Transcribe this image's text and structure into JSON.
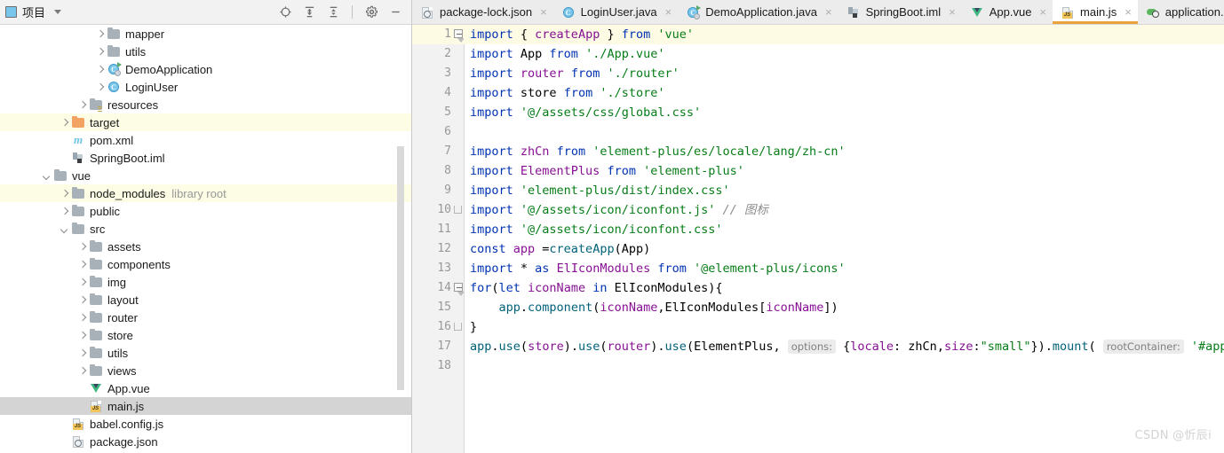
{
  "project_panel": {
    "title": "项目",
    "icon": "project-icon",
    "dropdown_icon": "chevron-down-icon",
    "tools": [
      {
        "name": "locate-file-icon",
        "label": "Select Opened File"
      },
      {
        "name": "expand-all-icon",
        "label": "Expand All"
      },
      {
        "name": "collapse-all-icon",
        "label": "Collapse All"
      },
      {
        "name": "gear-icon",
        "label": "Settings"
      },
      {
        "name": "minimize-icon",
        "label": "Hide"
      }
    ],
    "tree": [
      {
        "label": "mapper",
        "indent": 5,
        "arrow": "right",
        "icon": "folder-gray",
        "highlight": "none"
      },
      {
        "label": "utils",
        "indent": 5,
        "arrow": "right",
        "icon": "folder-gray",
        "highlight": "none"
      },
      {
        "label": "DemoApplication",
        "indent": 5,
        "arrow": "right",
        "icon": "java-class-run",
        "highlight": "none"
      },
      {
        "label": "LoginUser",
        "indent": 5,
        "arrow": "right",
        "icon": "java-class",
        "highlight": "none"
      },
      {
        "label": "resources",
        "indent": 4,
        "arrow": "right",
        "icon": "folder-res",
        "highlight": "none"
      },
      {
        "label": "target",
        "indent": 3,
        "arrow": "right",
        "icon": "folder-orange",
        "highlight": "yellow"
      },
      {
        "label": "pom.xml",
        "indent": 3,
        "arrow": "none",
        "icon": "maven",
        "highlight": "none"
      },
      {
        "label": "SpringBoot.iml",
        "indent": 3,
        "arrow": "none",
        "icon": "iml",
        "highlight": "none"
      },
      {
        "label": "vue",
        "indent": 2,
        "arrow": "down",
        "icon": "folder-gray",
        "highlight": "none"
      },
      {
        "label": "node_modules",
        "indent": 3,
        "arrow": "right",
        "icon": "folder-gray",
        "highlight": "yellow",
        "suffix": "library root"
      },
      {
        "label": "public",
        "indent": 3,
        "arrow": "right",
        "icon": "folder-gray",
        "highlight": "none"
      },
      {
        "label": "src",
        "indent": 3,
        "arrow": "down",
        "icon": "folder-gray",
        "highlight": "none"
      },
      {
        "label": "assets",
        "indent": 4,
        "arrow": "right",
        "icon": "folder-gray",
        "highlight": "none"
      },
      {
        "label": "components",
        "indent": 4,
        "arrow": "right",
        "icon": "folder-gray",
        "highlight": "none"
      },
      {
        "label": "img",
        "indent": 4,
        "arrow": "right",
        "icon": "folder-gray",
        "highlight": "none"
      },
      {
        "label": "layout",
        "indent": 4,
        "arrow": "right",
        "icon": "folder-gray",
        "highlight": "none"
      },
      {
        "label": "router",
        "indent": 4,
        "arrow": "right",
        "icon": "folder-gray",
        "highlight": "none"
      },
      {
        "label": "store",
        "indent": 4,
        "arrow": "right",
        "icon": "folder-gray",
        "highlight": "none"
      },
      {
        "label": "utils",
        "indent": 4,
        "arrow": "right",
        "icon": "folder-gray",
        "highlight": "none"
      },
      {
        "label": "views",
        "indent": 4,
        "arrow": "right",
        "icon": "folder-gray",
        "highlight": "none"
      },
      {
        "label": "App.vue",
        "indent": 4,
        "arrow": "none",
        "icon": "vue",
        "highlight": "none"
      },
      {
        "label": "main.js",
        "indent": 4,
        "arrow": "none",
        "icon": "js",
        "highlight": "selected"
      },
      {
        "label": "babel.config.js",
        "indent": 3,
        "arrow": "none",
        "icon": "js",
        "highlight": "none"
      },
      {
        "label": "package.json",
        "indent": 3,
        "arrow": "none",
        "icon": "json",
        "highlight": "none"
      }
    ]
  },
  "editor": {
    "tabs": [
      {
        "label": "package-lock.json",
        "icon": "json-file-icon",
        "active": false,
        "close": "×"
      },
      {
        "label": "LoginUser.java",
        "icon": "java-class-icon",
        "active": false,
        "close": "×"
      },
      {
        "label": "DemoApplication.java",
        "icon": "java-run-icon",
        "active": false,
        "close": "×"
      },
      {
        "label": "SpringBoot.iml",
        "icon": "iml-file-icon",
        "active": false,
        "close": "×"
      },
      {
        "label": "App.vue",
        "icon": "vue-file-icon",
        "active": false,
        "close": "×"
      },
      {
        "label": "main.js",
        "icon": "js-file-icon",
        "active": true,
        "close": "×"
      },
      {
        "label": "application.prop",
        "icon": "properties-icon",
        "active": false,
        "close": ""
      }
    ],
    "line_numbers": [
      "1",
      "2",
      "3",
      "4",
      "5",
      "6",
      "7",
      "8",
      "9",
      "10",
      "11",
      "12",
      "13",
      "14",
      "15",
      "16",
      "17",
      "18"
    ],
    "current_line": 1,
    "code": {
      "l1": {
        "kw1": "import",
        "p1": " { ",
        "f1": "createApp",
        "p2": " } ",
        "kw2": "from",
        "s1": " 'vue'"
      },
      "l2": {
        "kw1": "import",
        "id1": " App ",
        "kw2": "from",
        "s1": " './App.vue'"
      },
      "l3": {
        "kw1": "import",
        "f1": " router ",
        "kw2": "from",
        "s1": " './router'"
      },
      "l4": {
        "kw1": "import",
        "id1": " store ",
        "kw2": "from",
        "s1": " './store'"
      },
      "l5": {
        "kw1": "import",
        "s1": " '@/assets/css/global.css'"
      },
      "l7": {
        "kw1": "import",
        "f1": " zhCn ",
        "kw2": "from",
        "s1": " 'element-plus/es/locale/lang/zh-cn'"
      },
      "l8": {
        "kw1": "import",
        "f1": " ElementPlus ",
        "kw2": "from",
        "s1": " 'element-plus'"
      },
      "l9": {
        "kw1": "import",
        "s1": " 'element-plus/dist/index.css'"
      },
      "l10": {
        "kw1": "import",
        "s1": " '@/assets/icon/iconfont.js' ",
        "c1": "// ",
        "c2": "图标"
      },
      "l11": {
        "kw1": "import",
        "s1": " '@/assets/icon/iconfont.css'"
      },
      "l12": {
        "kw1": "const",
        "f1": " app ",
        "p1": "=",
        "f2": "createApp",
        "p2": "(",
        "id1": "App",
        "p3": ")"
      },
      "l13": {
        "kw1": "import",
        "p1": " * ",
        "kw2": "as",
        "f1": " ElIconModules ",
        "kw3": "from",
        "s1": " '@element-plus/icons'"
      },
      "l14": {
        "kw1": "for",
        "p1": "(",
        "kw2": "let",
        "f1": " iconName ",
        "kw3": "in",
        "id1": " ElIconModules",
        "p2": "){"
      },
      "l15": {
        "id1": "    app",
        "p1": ".",
        "fn1": "component",
        "p2": "(",
        "f1": "iconName",
        "p3": ",",
        "id2": "ElIconModules",
        "p4": "[",
        "f2": "iconName",
        "p5": "])"
      },
      "l16": {
        "p1": "}"
      },
      "l17": {
        "id1": "app",
        "p1": ".",
        "fn1": "use",
        "p2": "(",
        "f1": "store",
        "p3": ").",
        "fn2": "use",
        "p4": "(",
        "f2": "router",
        "p5": ").",
        "fn3": "use",
        "p6": "(",
        "id2": "ElementPlus",
        "p7": ", ",
        "h1": "options:",
        "p8": " {",
        "f3": "locale",
        "p9": ": ",
        "id3": "zhCn",
        "p10": ",",
        "f4": "size",
        "p11": ":",
        "s1": "\"small\"",
        "p12": "}).",
        "fn4": "mount",
        "p13": "( ",
        "h2": "rootContainer:",
        "s2": " '#app'",
        "p14": ")"
      }
    }
  },
  "watermark": "CSDN @忻辰i"
}
